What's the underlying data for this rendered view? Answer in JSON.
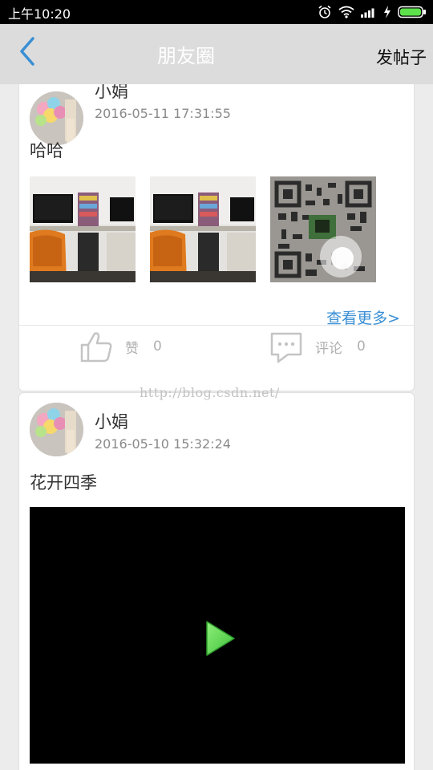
{
  "status_bar": {
    "time": "上午10:20"
  },
  "header": {
    "title": "朋友圈",
    "post_button_label": "发帖子",
    "back_icon": "chevron-left-icon",
    "accent_color": "#3a8fd4"
  },
  "posts": [
    {
      "user_name": "小娟",
      "timestamp": "2016-05-11 17:31:55",
      "text": "哈哈",
      "images": [
        "office-photo",
        "office-photo",
        "qr-code-photo"
      ],
      "more_label": "查看更多>",
      "like_label": "赞",
      "like_count": "0",
      "comment_label": "评论",
      "comment_count": "0"
    },
    {
      "user_name": "小娟",
      "timestamp": "2016-05-10 15:32:24",
      "text": "花开四季",
      "media": "video",
      "play_icon": "play-icon"
    }
  ],
  "watermark": "http://blog.csdn.net/"
}
